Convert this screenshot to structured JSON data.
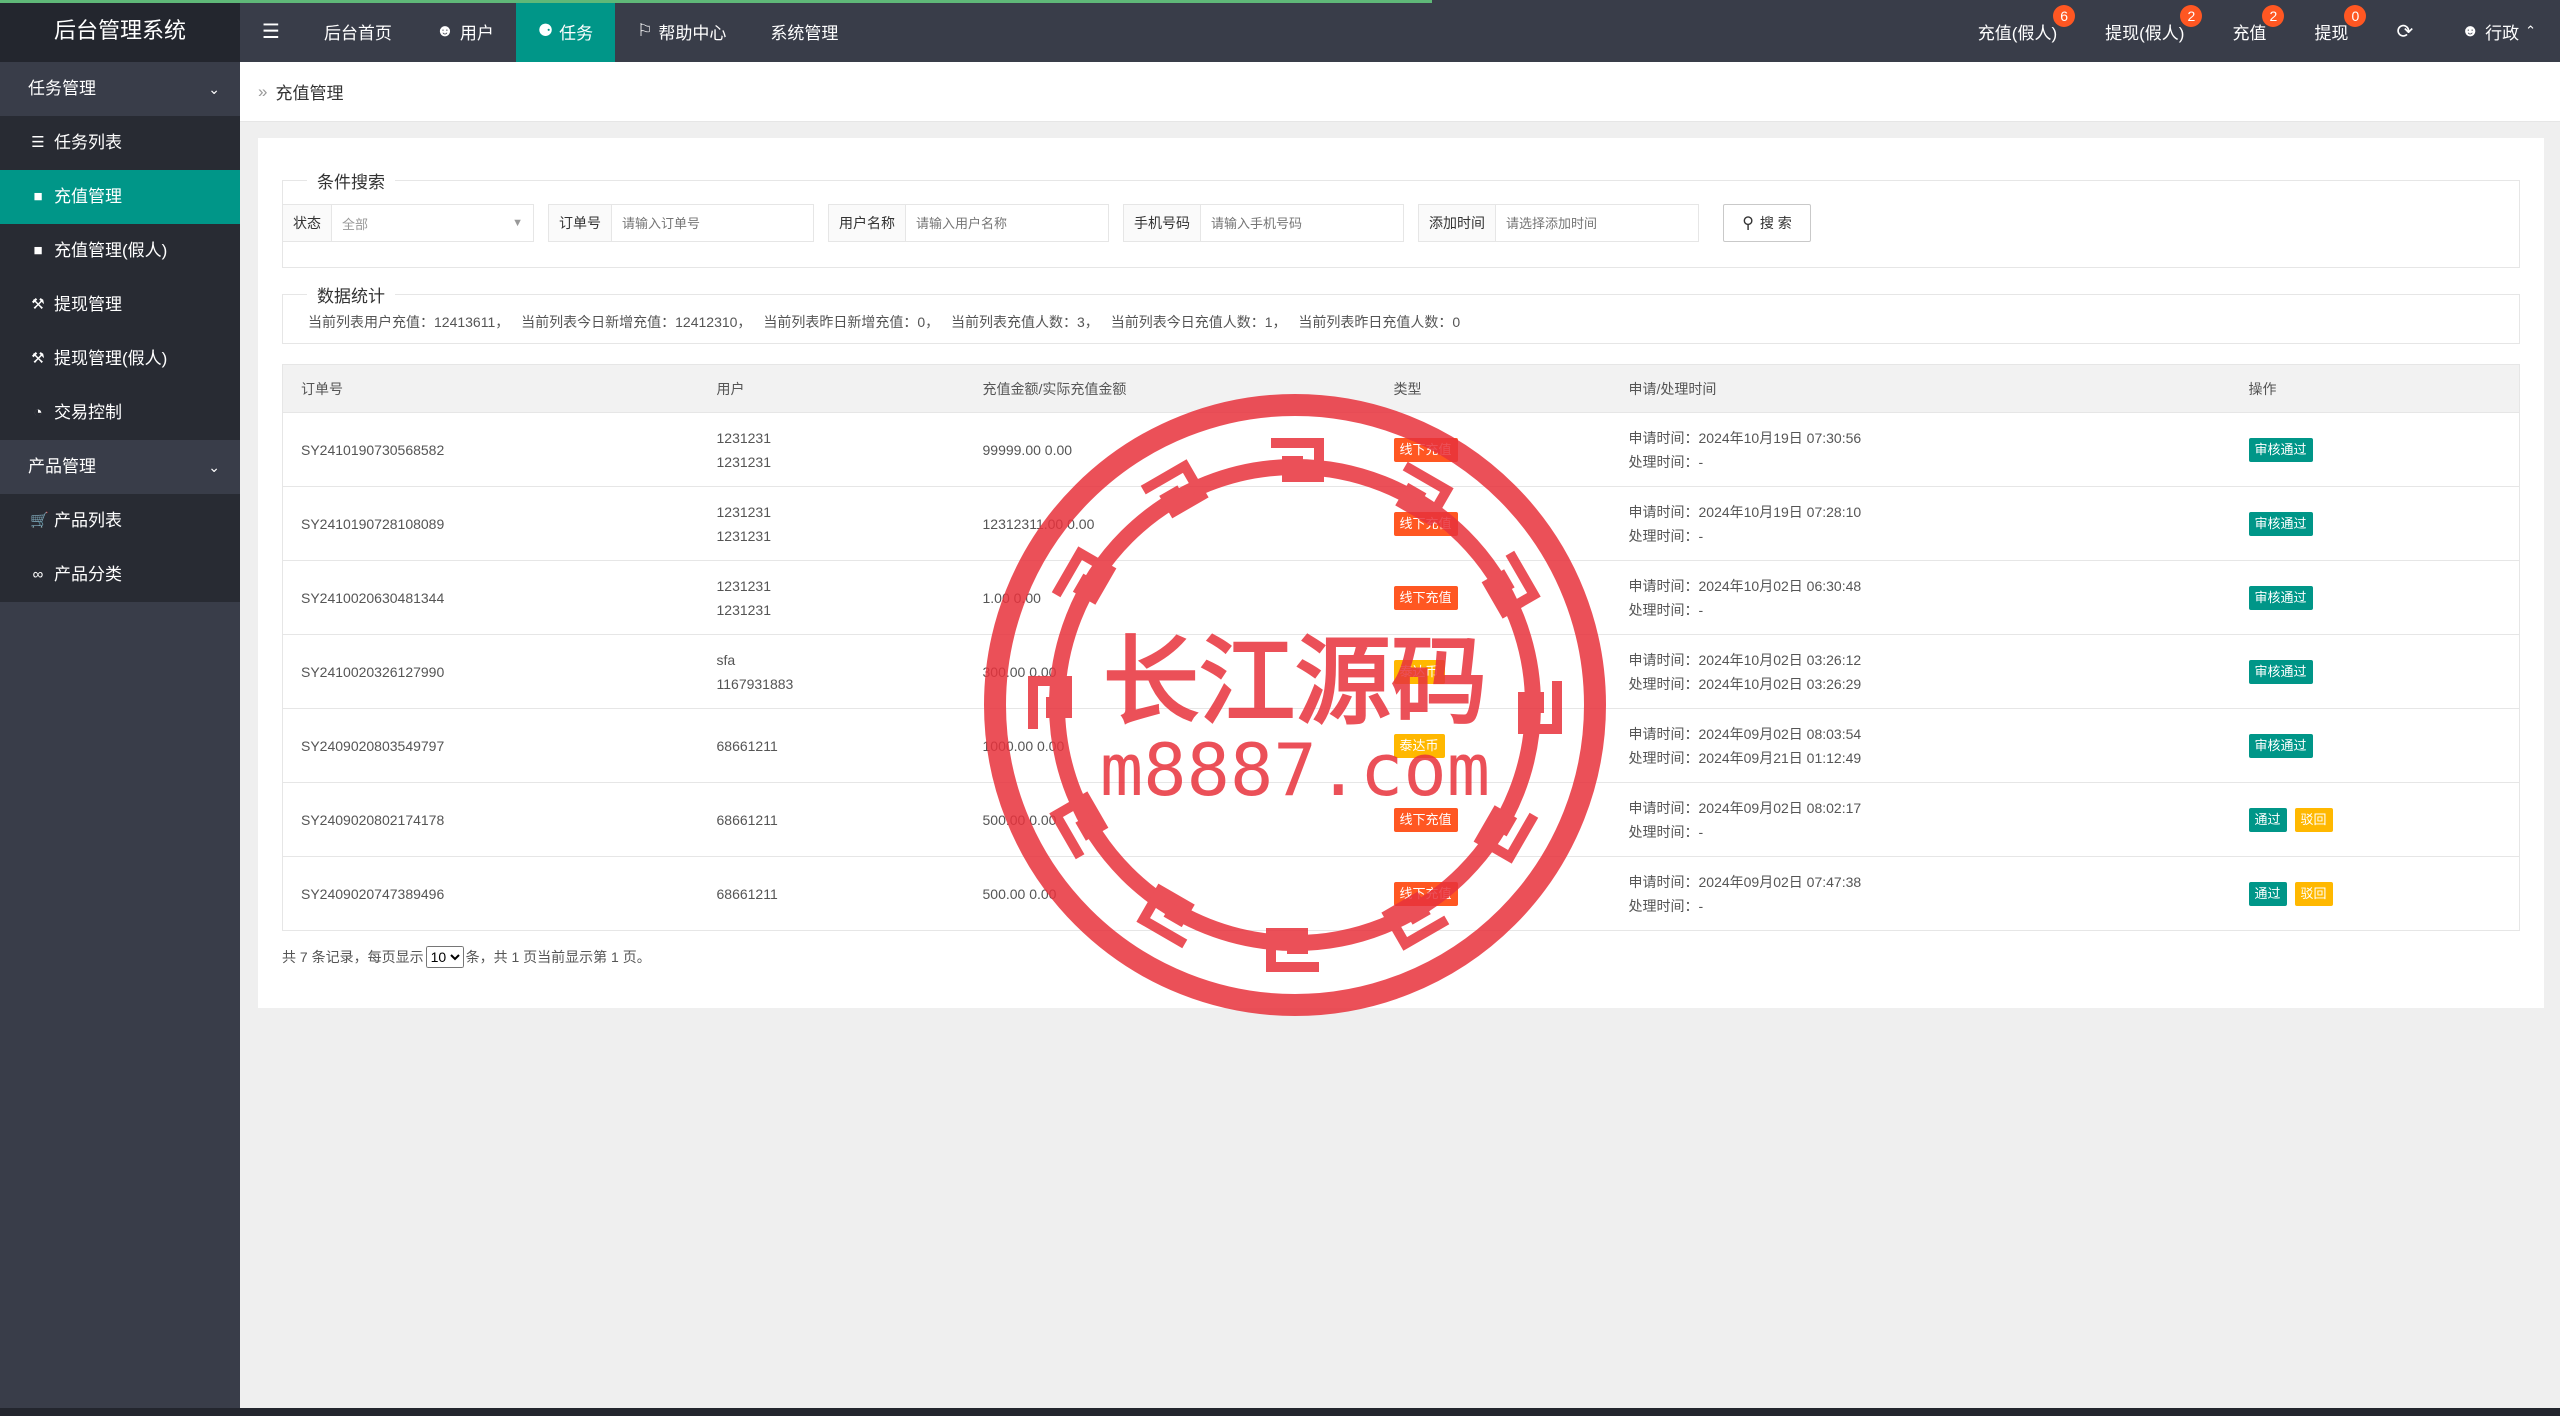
{
  "app": {
    "title": "后台管理系统"
  },
  "header": {
    "nav": [
      {
        "label": "后台首页"
      },
      {
        "label": "用户"
      },
      {
        "label": "任务"
      },
      {
        "label": "帮助中心"
      },
      {
        "label": "系统管理"
      }
    ],
    "right": [
      {
        "label": "充值(假人)",
        "badge": "6"
      },
      {
        "label": "提现(假人)",
        "badge": "2"
      },
      {
        "label": "充值",
        "badge": "2"
      },
      {
        "label": "提现",
        "badge": "0"
      }
    ],
    "user": "行政"
  },
  "sidebar": {
    "groups": [
      {
        "label": "任务管理",
        "items": [
          {
            "label": "任务列表",
            "icon": "list-icon"
          },
          {
            "label": "充值管理",
            "icon": "chat-icon"
          },
          {
            "label": "充值管理(假人)",
            "icon": "chat-icon"
          },
          {
            "label": "提现管理",
            "icon": "gavel-icon"
          },
          {
            "label": "提现管理(假人)",
            "icon": "gavel-icon"
          },
          {
            "label": "交易控制",
            "icon": "gauge-icon"
          }
        ]
      },
      {
        "label": "产品管理",
        "items": [
          {
            "label": "产品列表",
            "icon": "cart-icon"
          },
          {
            "label": "产品分类",
            "icon": "link-icon"
          }
        ]
      }
    ]
  },
  "breadcrumb": {
    "current": "充值管理"
  },
  "search": {
    "legend": "条件搜索",
    "status_label": "状态",
    "status_value": "全部",
    "order_label": "订单号",
    "order_placeholder": "请输入订单号",
    "username_label": "用户名称",
    "username_placeholder": "请输入用户名称",
    "phone_label": "手机号码",
    "phone_placeholder": "请输入手机号码",
    "addtime_label": "添加时间",
    "addtime_placeholder": "请选择添加时间",
    "button_label": "搜 索"
  },
  "stats": {
    "legend": "数据统计",
    "items": [
      "当前列表用户充值：12413611，",
      "当前列表今日新增充值：12412310，",
      "当前列表昨日新增充值：0，",
      "当前列表充值人数：3，",
      "当前列表今日充值人数：1，",
      "当前列表昨日充值人数：0"
    ]
  },
  "table": {
    "headers": [
      "订单号",
      "用户",
      "充值金额/实际充值金额",
      "类型",
      "申请/处理时间",
      "操作"
    ],
    "rows": [
      {
        "order": "SY2410190730568582",
        "user1": "1231231",
        "user2": "1231231",
        "amount": "99999.00 0.00",
        "type": "线下充值",
        "type_color": "red",
        "apply": "申请时间：2024年10月19日 07:30:56",
        "process": "处理时间：-",
        "actions": [
          "审核通过"
        ]
      },
      {
        "order": "SY2410190728108089",
        "user1": "1231231",
        "user2": "1231231",
        "amount": "12312311.00 0.00",
        "type": "线下充值",
        "type_color": "red",
        "apply": "申请时间：2024年10月19日 07:28:10",
        "process": "处理时间：-",
        "actions": [
          "审核通过"
        ]
      },
      {
        "order": "SY2410020630481344",
        "user1": "1231231",
        "user2": "1231231",
        "amount": "1.00 0.00",
        "type": "线下充值",
        "type_color": "red",
        "apply": "申请时间：2024年10月02日 06:30:48",
        "process": "处理时间：-",
        "actions": [
          "审核通过"
        ]
      },
      {
        "order": "SY2410020326127990",
        "user1": "sfa",
        "user2": "1167931883",
        "amount": "300.00 0.00",
        "type": "泰达币",
        "type_color": "orange",
        "apply": "申请时间：2024年10月02日 03:26:12",
        "process": "处理时间：2024年10月02日 03:26:29",
        "actions": [
          "审核通过"
        ]
      },
      {
        "order": "SY2409020803549797",
        "user1": "68661211",
        "user2": "",
        "amount": "1000.00 0.00",
        "type": "泰达币",
        "type_color": "orange",
        "apply": "申请时间：2024年09月02日 08:03:54",
        "process": "处理时间：2024年09月21日 01:12:49",
        "actions": [
          "审核通过"
        ]
      },
      {
        "order": "SY2409020802174178",
        "user1": "68661211",
        "user2": "",
        "amount": "500.00 0.00",
        "type": "线下充值",
        "type_color": "red",
        "apply": "申请时间：2024年09月02日 08:02:17",
        "process": "处理时间：-",
        "actions": [
          "通过",
          "驳回"
        ]
      },
      {
        "order": "SY2409020747389496",
        "user1": "68661211",
        "user2": "",
        "amount": "500.00 0.00",
        "type": "线下充值",
        "type_color": "red",
        "apply": "申请时间：2024年09月02日 07:47:38",
        "process": "处理时间：-",
        "actions": [
          "通过",
          "驳回"
        ]
      }
    ]
  },
  "pager": {
    "prefix": "共 7 条记录，每页显示",
    "page_size": "10",
    "suffix": "条，共 1 页当前显示第 1 页。"
  },
  "watermark": {
    "line1": "长江源码",
    "line2": "m8887.com"
  }
}
